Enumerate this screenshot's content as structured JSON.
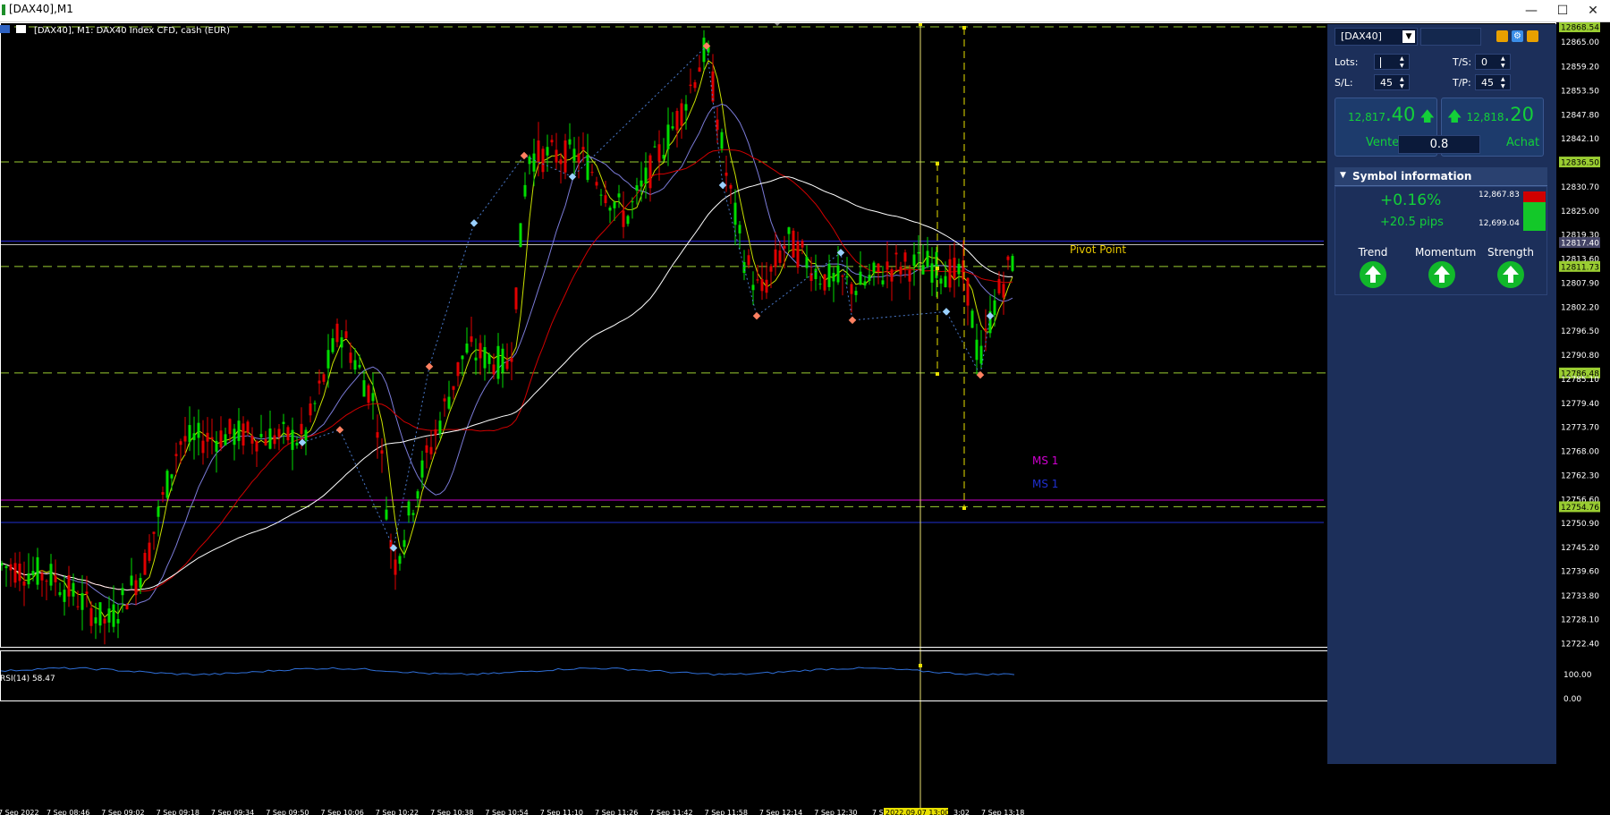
{
  "window": {
    "title": "[DAX40],M1",
    "minimize": "—",
    "maximize": "☐",
    "close": "✕"
  },
  "chart": {
    "header": "[DAX40], M1:  DAX40 Index CFD, cash (EUR)",
    "price_labels": [
      "12868.54",
      "12865.00",
      "12859.20",
      "12853.50",
      "12847.80",
      "12842.10",
      "12836.50",
      "12830.70",
      "12825.00",
      "12819.30",
      "12817.40",
      "12813.60",
      "12811.73",
      "12807.90",
      "12802.20",
      "12796.50",
      "12790.80",
      "12786.48",
      "12785.10",
      "12779.40",
      "12773.70",
      "12768.00",
      "12762.30",
      "12756.60",
      "12754.76",
      "12750.90",
      "12745.20",
      "12739.60",
      "12733.80",
      "12728.10",
      "12722.40"
    ],
    "highlighted_levels": [
      "12868.54",
      "12836.50",
      "12811.73",
      "12786.48",
      "12754.76"
    ],
    "current_price": "12817.40",
    "time_labels": [
      "7 Sep 2022",
      "7 Sep 08:46",
      "7 Sep 09:02",
      "7 Sep 09:18",
      "7 Sep 09:34",
      "7 Sep 09:50",
      "7 Sep 10:06",
      "7 Sep 10:22",
      "7 Sep 10:38",
      "7 Sep 10:54",
      "7 Sep 11:10",
      "7 Sep 11:26",
      "7 Sep 11:42",
      "7 Sep 11:58",
      "7 Sep 12:14",
      "7 Sep 12:30",
      "7 Sep",
      "2022.09.07 13:00",
      "3:02",
      "7 Sep 13:18"
    ],
    "cursor_time": "2022.09.07 13:00",
    "pivot_label": "Pivot Point",
    "ms1_magenta": "MS 1",
    "ms1_blue": "MS 1",
    "rsi_label": "RSI(14) 58.47",
    "rsi_ticks": [
      "100.00",
      "0.00"
    ],
    "colors": {
      "bull": "#00dd00",
      "bear": "#e00000",
      "level": "#9acd32",
      "pivot": "#e8c800",
      "ms1_magenta": "#d000d0",
      "ms1_blue": "#1f2fd0",
      "rsi": "#2f6fd8"
    }
  },
  "panel": {
    "symbol": "[DAX40]",
    "icons": [
      "copy-icon",
      "gear-icon",
      "expand-icon"
    ],
    "lots_label": "Lots:",
    "lots_value": "",
    "ts_label": "T/S:",
    "ts_value": "0",
    "sl_label": "S/L:",
    "sl_value": "45",
    "tp_label": "T/P:",
    "tp_value": "45",
    "sell_price_small": "12,817",
    "sell_price_large": ".40",
    "sell_label": "Vente",
    "buy_price_small": "12,818",
    "buy_price_large": ".20",
    "buy_label": "Achat",
    "spread": "0.8",
    "symbol_info_title": "Symbol information",
    "change_pct": "+0.16%",
    "change_pips": "+20.5 pips",
    "range_high": "12,867.83",
    "range_low": "12,699.04",
    "trend_label": "Trend",
    "momentum_label": "Momentum",
    "strength_label": "Strength"
  }
}
